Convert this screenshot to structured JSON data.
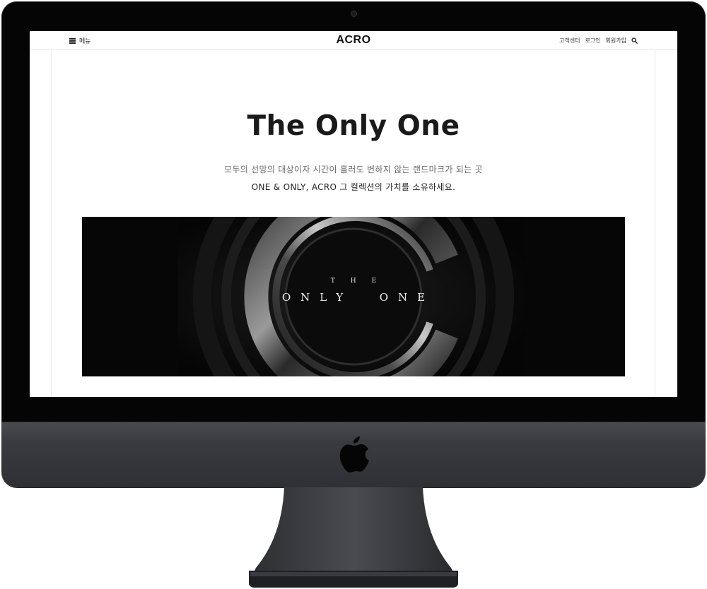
{
  "header": {
    "menu_label": "메뉴",
    "logo": "ACRO",
    "nav": [
      "고객센터",
      "로그인",
      "회원가입"
    ]
  },
  "hero": {
    "title": "The Only One",
    "subtitle_line1": "모두의 선망의 대상이자 시간이 흘러도 변하지 않는 랜드마크가 되는 곳",
    "subtitle_line2": "ONE & ONLY, ACRO 그 컬렉션의 가치를 소유하세요."
  },
  "banner": {
    "small_text": "THE",
    "large_text": "ONLY  ONE"
  },
  "icons": {
    "menu": "hamburger-icon",
    "search": "search-icon",
    "brand": "apple-logo-icon"
  },
  "colors": {
    "bezel": "#050505",
    "chin": "#3a3b40",
    "page_bg": "#ffffff",
    "text_dark": "#1a1a1a",
    "banner_bg": "#080808"
  }
}
